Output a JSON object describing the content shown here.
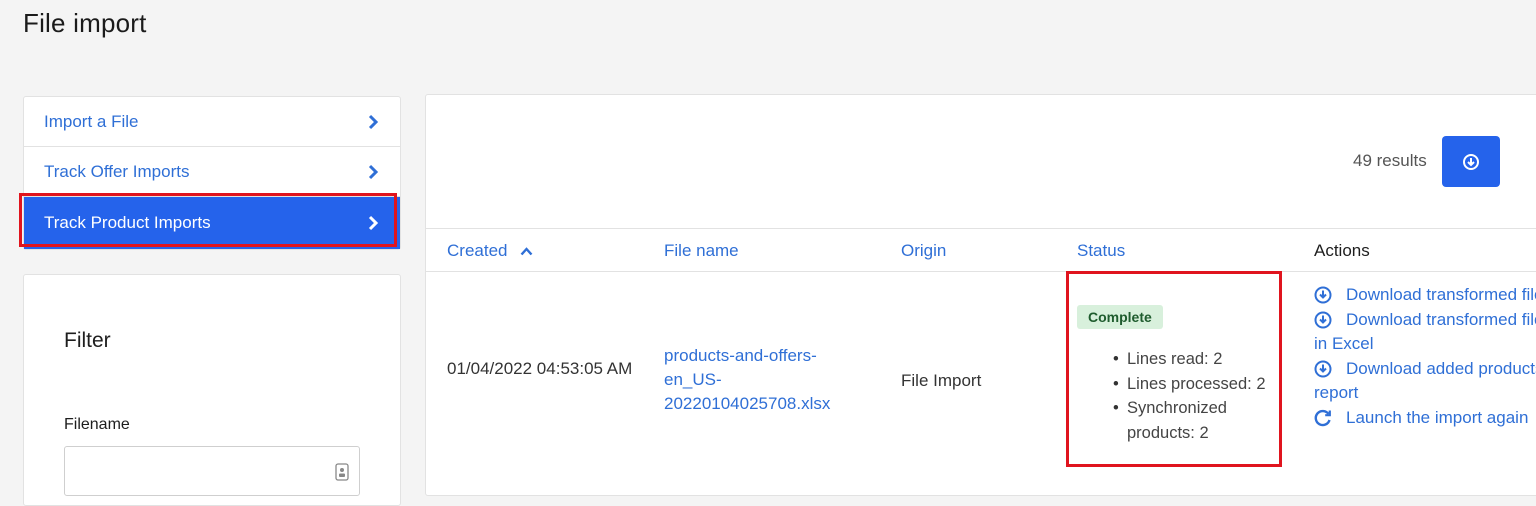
{
  "page": {
    "title": "File import"
  },
  "nav": {
    "items": [
      {
        "label": "Import a File"
      },
      {
        "label": "Track Offer Imports"
      },
      {
        "label": "Track Product Imports"
      }
    ]
  },
  "filter": {
    "title": "Filter",
    "filename_label": "Filename",
    "filename_value": ""
  },
  "results": {
    "count_text": "49 results"
  },
  "table": {
    "headers": {
      "created": "Created",
      "file_name": "File name",
      "origin": "Origin",
      "status": "Status",
      "actions": "Actions"
    },
    "rows": [
      {
        "created": "01/04/2022 04:53:05 AM",
        "file_name": "products-and-offers-en_US-20220104025708.xlsx",
        "origin": "File Import",
        "status_badge": "Complete",
        "stats": [
          "Lines read: 2",
          "Lines processed: 2",
          "Synchronized products: 2"
        ],
        "actions": [
          {
            "label": "Download transformed file",
            "icon": "download-circle-icon"
          },
          {
            "label": "Download transformed file in Excel",
            "icon": "download-circle-icon"
          },
          {
            "label": "Download added products report",
            "icon": "download-circle-icon"
          },
          {
            "label": "Launch the import again",
            "icon": "refresh-icon"
          }
        ]
      }
    ]
  },
  "colors": {
    "accent": "#2563eb",
    "link": "#2f6fd6",
    "highlight": "#e0141e",
    "badge_bg": "#d8f0dc"
  }
}
